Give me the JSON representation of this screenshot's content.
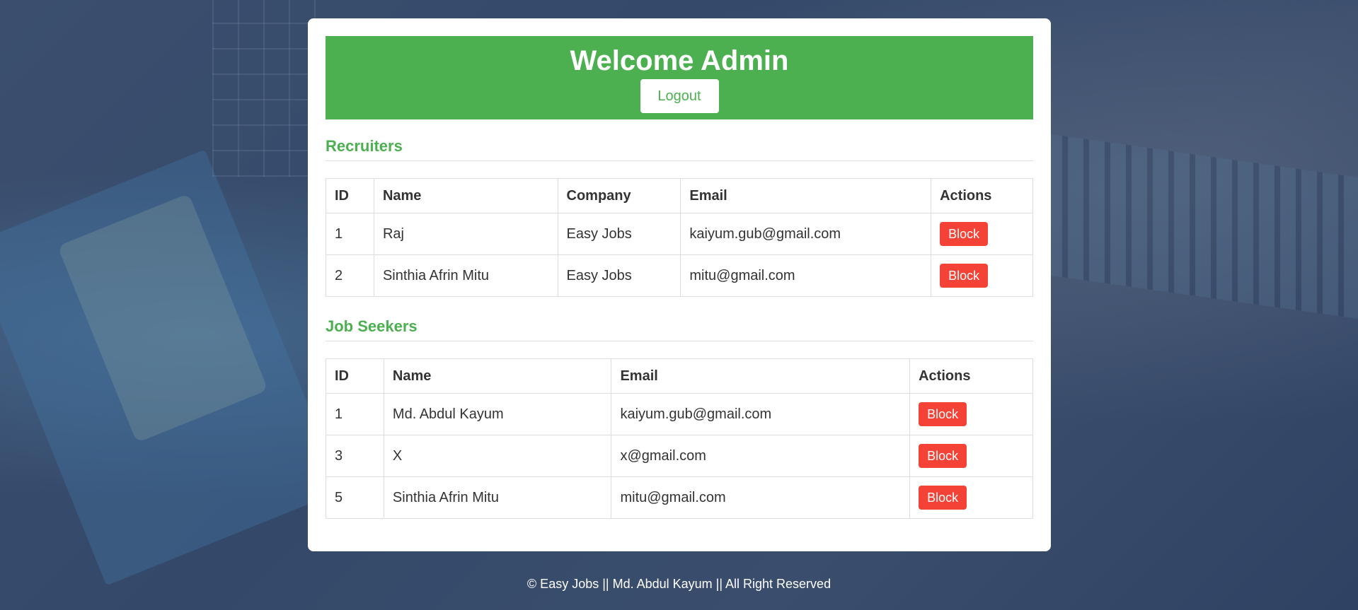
{
  "header": {
    "title": "Welcome Admin",
    "logout_label": "Logout"
  },
  "recruiters": {
    "title": "Recruiters",
    "columns": [
      "ID",
      "Name",
      "Company",
      "Email",
      "Actions"
    ],
    "rows": [
      {
        "id": "1",
        "name": "Raj",
        "company": "Easy Jobs",
        "email": "kaiyum.gub@gmail.com",
        "action": "Block"
      },
      {
        "id": "2",
        "name": "Sinthia Afrin Mitu",
        "company": "Easy Jobs",
        "email": "mitu@gmail.com",
        "action": "Block"
      }
    ]
  },
  "job_seekers": {
    "title": "Job Seekers",
    "columns": [
      "ID",
      "Name",
      "Email",
      "Actions"
    ],
    "rows": [
      {
        "id": "1",
        "name": "Md. Abdul Kayum",
        "email": "kaiyum.gub@gmail.com",
        "action": "Block"
      },
      {
        "id": "3",
        "name": "X",
        "email": "x@gmail.com",
        "action": "Block"
      },
      {
        "id": "5",
        "name": "Sinthia Afrin Mitu",
        "email": "mitu@gmail.com",
        "action": "Block"
      }
    ]
  },
  "footer": {
    "text": "© Easy Jobs || Md. Abdul Kayum || All Right Reserved"
  },
  "colors": {
    "accent": "#4caf50",
    "danger": "#f44336",
    "background": "#3b4e6e"
  }
}
